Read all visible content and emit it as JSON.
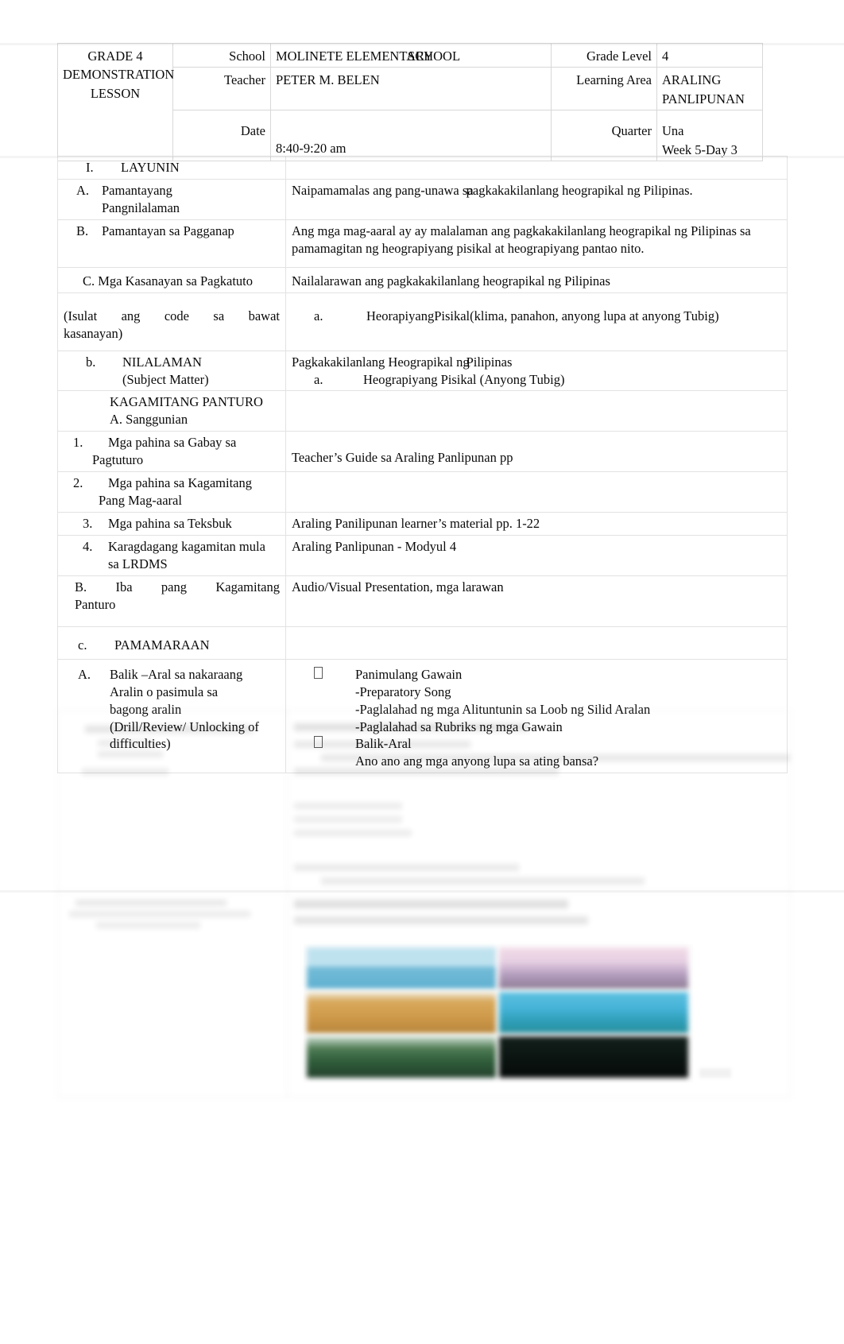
{
  "document": {
    "type": "lesson-plan",
    "language": "Filipino"
  },
  "header": {
    "title_lines": [
      "GRADE 4",
      "DEMONSTRATION",
      "LESSON"
    ],
    "title": "GRADE 4 DEMONSTRATION LESSON",
    "fields": [
      {
        "label": "School",
        "value": "MOLINETE ELEMENTARY SCHOOL"
      },
      {
        "label": "Teacher",
        "value": "PETER M. BELEN"
      },
      {
        "label": "Date",
        "value": ""
      },
      {
        "label": "",
        "value": "8:40-9:20 am"
      }
    ],
    "right_fields": [
      {
        "label": "Grade Level",
        "value": "4"
      },
      {
        "label": "Learning Area",
        "value": "ARALING PANLIPUNAN"
      },
      {
        "label": "Quarter",
        "value": "Una"
      },
      {
        "label": "",
        "value": "Week 5-Day 3"
      }
    ],
    "school_overlap": {
      "part_a": "MOLINETE ELEMENTARY",
      "part_b": "SCHOOL"
    },
    "learning_area_lines": [
      "ARALING",
      "PANLIPUNAN"
    ]
  },
  "sections": {
    "layunin": {
      "roman": "I.",
      "heading": "LAYUNIN",
      "items": [
        {
          "mark": "A.",
          "label_lines": [
            "Pamantayang",
            "Pangnilalaman"
          ],
          "value_pre": "Naipamamalas ang pang-unawa sa",
          "value_overlap": "pagkakakilanlang heograpikal ng Pilipinas.",
          "value": "Naipamamalas ang pang-unawa sa pagkakakilanlang heograpikal ng Pilipinas."
        },
        {
          "mark": "B.",
          "label_lines": [
            "Pamantayan sa Pagganap"
          ],
          "value": "Ang mga mag-aaral ay ay malalaman ang pagkakakilanlang heograpikal ng Pilipinas sa pamamagitan ng heograpiyang pisikal at heograpiyang pantao nito."
        }
      ],
      "kasanayan": {
        "label": "C. Mga Kasanayan sa Pagkatuto",
        "note_lines": [
          "(Isulat  ang  code  sa  bawat",
          "kasanayan)"
        ],
        "note": "(Isulat ang code sa bawat kasanayan)",
        "value": "Nailalarawan ang pagkakakilanlang heograpikal ng Pilipinas",
        "sub_mark": "a.",
        "sub_pre": "Heorapiyang",
        "sub_post": "Pisikal(klima, panahon, anyong lupa at anyong Tubig)",
        "sub_value": "Heorapiyang Pisikal(klima, panahon, anyong lupa at anyong Tubig)"
      }
    },
    "nilalaman": {
      "mark": "b.",
      "heading": "NILALAMAN",
      "subheading": "(Subject Matter)",
      "value_pre": "Pagkakakilanlang Heograpikal ng",
      "value_post": "Pilipinas",
      "value": "Pagkakakilanlang Heograpikal ng Pilipinas",
      "sub_mark": "a.",
      "sub_value": "Heograpiyang Pisikal (Anyong Tubig)"
    },
    "kagamitang_panturo": {
      "heading": "KAGAMITANG PANTURO",
      "subheading": "A. Sanggunian",
      "rows": [
        {
          "mark": "1.",
          "label_lines": [
            "Mga pahina sa Gabay sa",
            "Pagtuturo"
          ],
          "label": "Mga pahina sa Gabay sa Pagtuturo",
          "value": "Teacher’s Guide sa Araling Panlipunan pp"
        },
        {
          "mark": "2.",
          "label_lines": [
            "Mga pahina sa Kagamitang",
            "Pang Mag-aaral"
          ],
          "label": "Mga pahina sa Kagamitang Pang Mag-aaral",
          "value": ""
        },
        {
          "mark": "3.",
          "label_lines": [
            "Mga pahina sa Teksbuk"
          ],
          "label": "Mga pahina sa Teksbuk",
          "value": "Araling Panilipunan learner’s material pp. 1-22"
        },
        {
          "mark": "4.",
          "label_lines": [
            "Karagdagang kagamitan mula",
            "sa  LRDMS"
          ],
          "label": "Karagdagang kagamitan mula sa LRDMS",
          "value": "Araling Panlipunan - Modyul 4"
        }
      ],
      "iba_pang": {
        "label_lines": [
          "B.  Iba  pang  Kagamitang",
          "Panturo"
        ],
        "label": "B. Iba pang Kagamitang Panturo",
        "value": "Audio/Visual Presentation, mga larawan"
      }
    },
    "pamamaraan": {
      "mark": "c.",
      "heading": "PAMAMARAAN",
      "rows": [
        {
          "mark": "A.",
          "label_lines": [
            "Balik –Aral sa nakaraang",
            "Aralin o pasimula sa",
            "bagong aralin",
            " (Drill/Review/ Unlocking of",
            "difficulties)"
          ],
          "label": "Balik –Aral sa nakaraang Aralin o pasimula sa bagong aralin (Drill/Review/ Unlocking of difficulties)",
          "bullets": [
            {
              "bullet": "box-bullet-glyph",
              "title": "Panimulang Gawain",
              "lines": [
                "-Preparatory Song",
                "-Paglalahad ng mga Alituntunin sa Loob ng Silid Aralan",
                "-Paglalahad sa Rubriks ng mga Gawain"
              ]
            },
            {
              "bullet": "box-bullet-glyph",
              "title": "Balik-Aral",
              "lines": [
                "Ano ano ang mga anyong lupa sa ating bansa?"
              ]
            }
          ]
        }
      ]
    },
    "obscured_region": {
      "note": "lower portion of page is blurred and illegible",
      "left_placeholder_lines": [
        "",
        "",
        ""
      ],
      "right_placeholder_lines": [
        "",
        "",
        "",
        "",
        ""
      ]
    }
  },
  "pictures": {
    "caption": "",
    "tiles": [
      {
        "name": "beach-photo",
        "tone": "#bfe2ef"
      },
      {
        "name": "sunset-photo",
        "tone": "#e6cfe2"
      },
      {
        "name": "field-photo",
        "tone": "#d9a95c"
      },
      {
        "name": "sea-photo",
        "tone": "#45b3d8"
      },
      {
        "name": "lake-photo",
        "tone": "#2f5c3a"
      },
      {
        "name": "night-photo",
        "tone": "#0d1713"
      }
    ]
  }
}
